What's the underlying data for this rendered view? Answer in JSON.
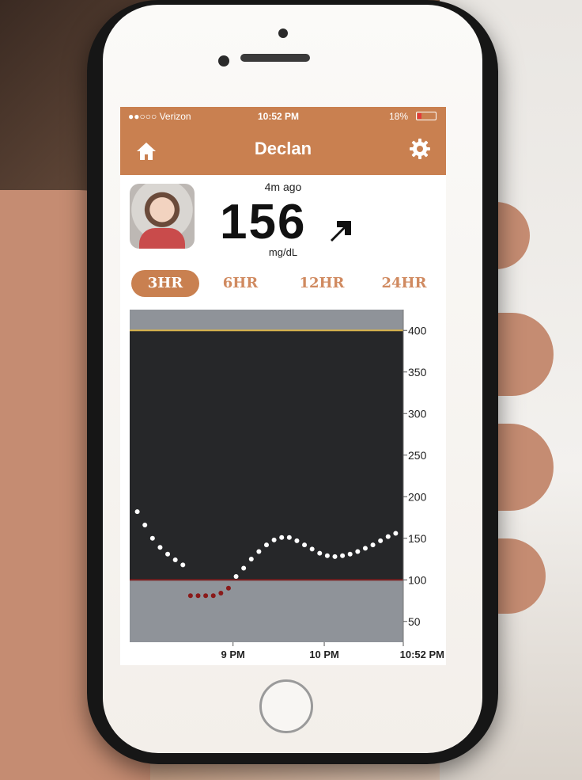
{
  "status": {
    "carrier": "●●○○○ Verizon",
    "time": "10:52 PM",
    "battery": "18%"
  },
  "nav": {
    "title": "Declan",
    "left_icon": "home-icon",
    "right_icon": "gear-icon"
  },
  "reading": {
    "time_ago": "4m ago",
    "value": "156",
    "unit": "mg/dL",
    "trend_icon": "arrow-up-right-icon"
  },
  "tabs": [
    {
      "label": "3HR",
      "active": true
    },
    {
      "label": "6HR",
      "active": false
    },
    {
      "label": "12HR",
      "active": false
    },
    {
      "label": "24HR",
      "active": false
    }
  ],
  "colors": {
    "accent": "#c98050",
    "chart_bg": "#262729",
    "band": "#8f9399",
    "high_line": "#d7b24a",
    "low_line": "#7a1f1f",
    "in_range_point": "#ffffff",
    "low_point": "#8a1a1a"
  },
  "chart_data": {
    "type": "scatter",
    "x_unit": "minutes",
    "xlim": [
      0,
      180
    ],
    "ylim": [
      25,
      425
    ],
    "y_ticks": [
      400,
      350,
      300,
      250,
      200,
      150,
      100,
      50
    ],
    "x_ticks": [
      {
        "label": "9 PM",
        "x": 68
      },
      {
        "label": "10 PM",
        "x": 128
      },
      {
        "label": "10:52 PM",
        "x": 180
      }
    ],
    "high_threshold": 400,
    "low_threshold": 100,
    "series": [
      {
        "points": [
          [
            5,
            182
          ],
          [
            10,
            166
          ],
          [
            15,
            150
          ],
          [
            20,
            139
          ],
          [
            25,
            131
          ],
          [
            30,
            124
          ],
          [
            35,
            118
          ],
          [
            70,
            104
          ],
          [
            75,
            114
          ],
          [
            80,
            125
          ],
          [
            85,
            134
          ],
          [
            90,
            142
          ],
          [
            95,
            148
          ],
          [
            100,
            151
          ],
          [
            105,
            151
          ],
          [
            110,
            147
          ],
          [
            115,
            142
          ],
          [
            120,
            137
          ],
          [
            125,
            132
          ],
          [
            130,
            129
          ],
          [
            135,
            128
          ],
          [
            140,
            129
          ],
          [
            145,
            131
          ],
          [
            150,
            134
          ],
          [
            155,
            138
          ],
          [
            160,
            142
          ],
          [
            165,
            147
          ],
          [
            170,
            152
          ],
          [
            175,
            156
          ]
        ]
      },
      {
        "points": [
          [
            40,
            81
          ],
          [
            45,
            81
          ],
          [
            50,
            81
          ],
          [
            55,
            81
          ],
          [
            60,
            84
          ],
          [
            65,
            90
          ]
        ]
      }
    ]
  }
}
